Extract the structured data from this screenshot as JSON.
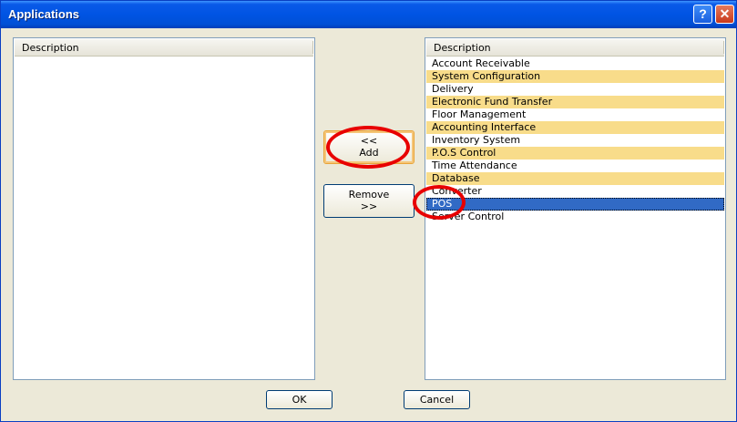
{
  "window": {
    "title": "Applications"
  },
  "titlebar": {
    "help_label": "?",
    "close_label": "✕"
  },
  "left_list": {
    "header": "Description",
    "items": []
  },
  "right_list": {
    "header": "Description",
    "items": [
      "Account Receivable",
      "System Configuration",
      "Delivery",
      "Electronic Fund Transfer",
      "Floor Management",
      "Accounting Interface",
      "Inventory System",
      "P.O.S Control",
      "Time Attendance",
      "Database",
      "Converter",
      "POS",
      "Server Control"
    ],
    "selected_index": 11
  },
  "buttons": {
    "add_line1": "<<",
    "add_line2": "Add",
    "remove_line1": "Remove",
    "remove_line2": ">>",
    "ok": "OK",
    "cancel": "Cancel"
  },
  "colors": {
    "alt_row": "#f8dc8a",
    "selected_row": "#316ac5",
    "annotation": "#e80000"
  }
}
